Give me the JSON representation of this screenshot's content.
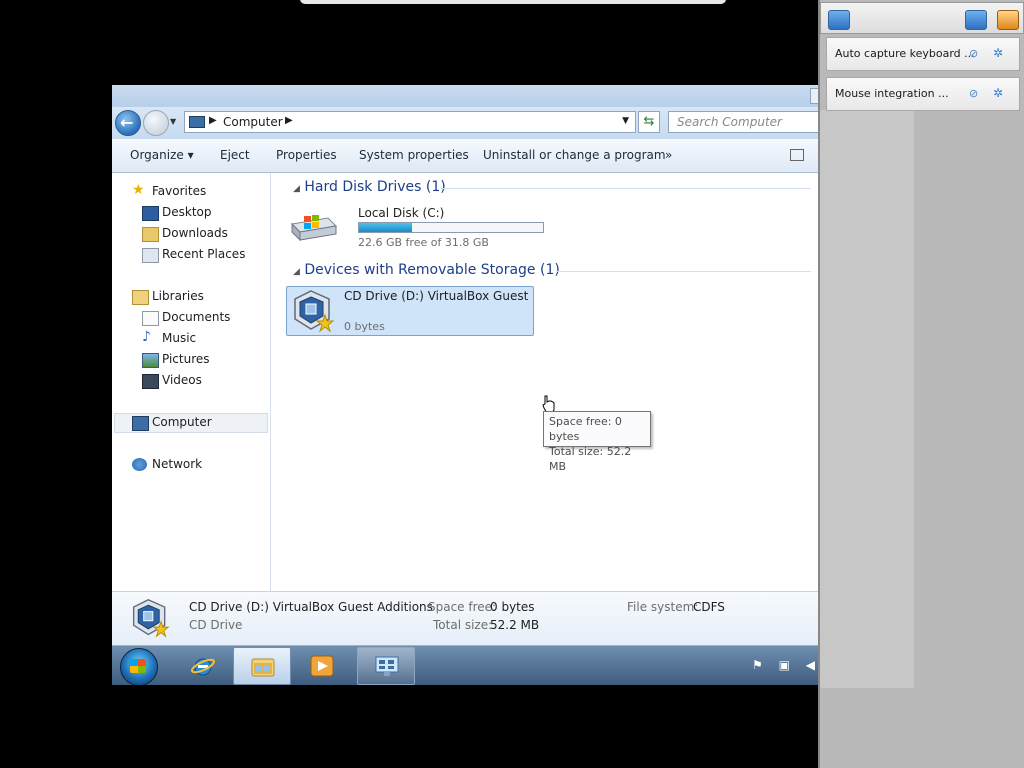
{
  "explorer": {
    "address": {
      "crumb": "Computer",
      "search_placeholder": "Search Computer"
    },
    "commands": [
      "Organize ▾",
      "Eject",
      "Properties",
      "System properties",
      "Uninstall or change a program",
      "»"
    ],
    "nav": {
      "favorites": "Favorites",
      "desktop": "Desktop",
      "downloads": "Downloads",
      "recent": "Recent Places",
      "libraries": "Libraries",
      "documents": "Documents",
      "music": "Music",
      "pictures": "Pictures",
      "videos": "Videos",
      "computer": "Computer",
      "network": "Network"
    },
    "groups": {
      "hdd": "Hard Disk Drives (1)",
      "removable": "Devices with Removable Storage (1)"
    },
    "local_disk": {
      "name": "Local Disk (C:)",
      "free_text": "22.6 GB free of 31.8 GB",
      "used_fraction": 0.29
    },
    "cd_drive": {
      "name": "CD Drive (D:) VirtualBox Guest Additions",
      "bytes": "0 bytes"
    },
    "tooltip": {
      "line1": "Space free: 0 bytes",
      "line2": "Total size: 52.2 MB"
    },
    "details": {
      "name": "CD Drive (D:) VirtualBox Guest Additions",
      "type": "CD Drive",
      "space_free_label": "Space free:",
      "space_free_value": "0 bytes",
      "total_size_label": "Total size:",
      "total_size_value": "52.2 MB",
      "fs_label": "File system:",
      "fs_value": "CDFS"
    }
  },
  "taskbar": {
    "buttons": [
      "start-orb",
      "internet-explorer",
      "windows-explorer",
      "media-player",
      "virtualbox-display"
    ]
  },
  "vbox_panel": {
    "rows": [
      {
        "label": "Auto capture keyboard ..."
      },
      {
        "label": "Mouse integration ..."
      }
    ]
  }
}
